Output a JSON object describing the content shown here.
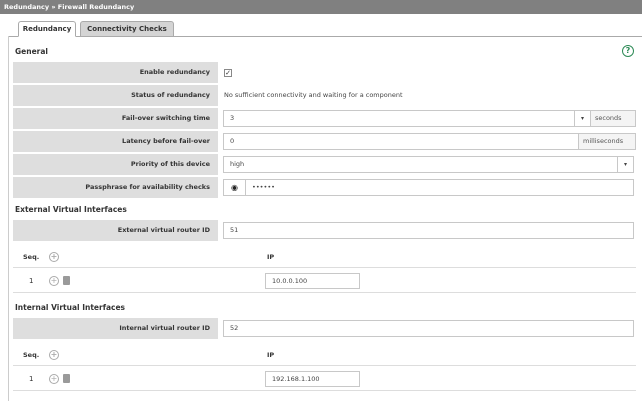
{
  "breadcrumb": "Redundancy » Firewall Redundancy",
  "tabs": [
    {
      "label": "Redundancy",
      "active": true
    },
    {
      "label": "Connectivity Checks",
      "active": false
    }
  ],
  "general": {
    "title": "General",
    "help_icon": "question-circle-icon",
    "enable_redundancy": {
      "label": "Enable redundancy",
      "checked": true
    },
    "status": {
      "label": "Status of redundancy",
      "value": "No sufficient connectivity and waiting for a component"
    },
    "failover": {
      "label": "Fail-over switching time",
      "value": "3",
      "unit": "seconds"
    },
    "latency": {
      "label": "Latency before fail-over",
      "value": "0",
      "unit": "milliseconds"
    },
    "priority": {
      "label": "Priority of this device",
      "value": "high"
    },
    "passphrase": {
      "label": "Passphrase for availability checks",
      "value": "••••••"
    }
  },
  "external": {
    "title": "External Virtual Interfaces",
    "router_id": {
      "label": "External virtual router ID",
      "value": "51"
    },
    "columns": {
      "seq": "Seq.",
      "ip": "IP"
    },
    "rows": [
      {
        "seq": "1",
        "ip": "10.0.0.100"
      }
    ]
  },
  "internal": {
    "title": "Internal Virtual Interfaces",
    "router_id": {
      "label": "Internal virtual router ID",
      "value": "52"
    },
    "columns": {
      "seq": "Seq.",
      "ip": "IP"
    },
    "rows": [
      {
        "seq": "1",
        "ip": "192.168.1.100"
      }
    ]
  },
  "colors": {
    "label_bg": "#dedede",
    "accent_green": "#2e8b57",
    "titlebar": "#808080"
  }
}
